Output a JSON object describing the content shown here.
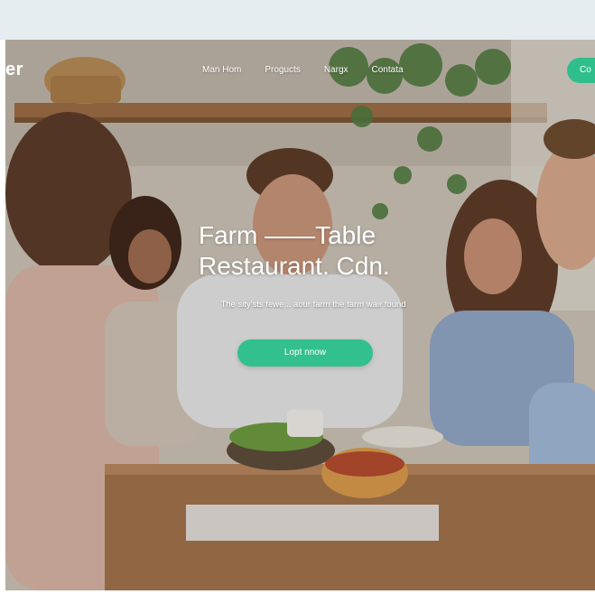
{
  "brand": {
    "name": "er"
  },
  "nav": {
    "links": [
      "Man Hom",
      "Progucts",
      "Nargx",
      "Contata"
    ],
    "cta_label": "Co"
  },
  "hero": {
    "headline_line1": "Farm ——Table",
    "headline_line2": "Restaurant. Cdn.",
    "subline": "The sity'sts fewe... aour farm the farm wair found",
    "cta_label": "Lopt nnow"
  },
  "colors": {
    "accent": "#32c08e",
    "top_band": "#e6edf1"
  }
}
